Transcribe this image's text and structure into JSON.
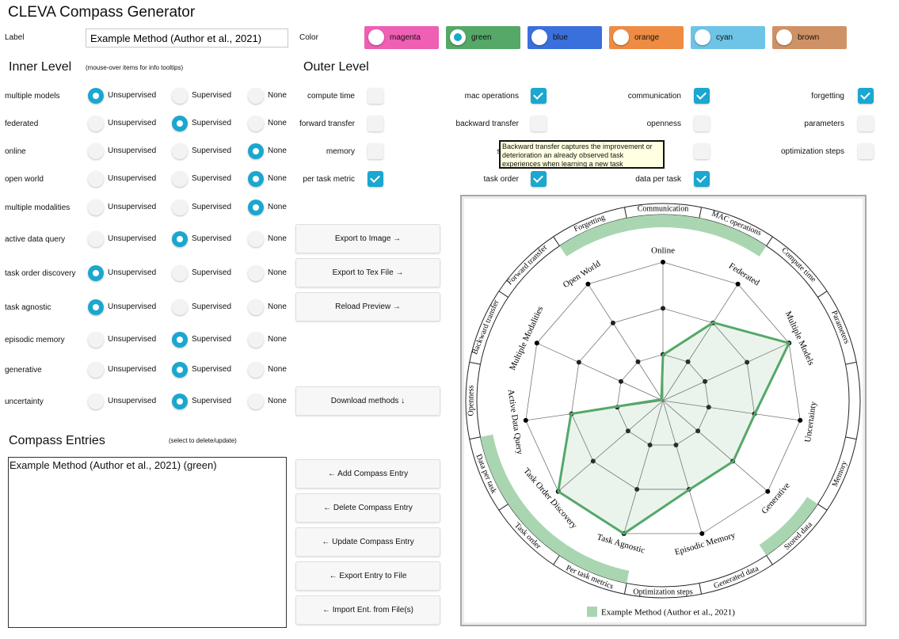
{
  "app_title": "CLEVA Compass Generator",
  "label_section": {
    "label": "Label",
    "value": "Example Method (Author et al., 2021)"
  },
  "color_section": {
    "label": "Color",
    "options": [
      {
        "name": "magenta",
        "hex": "#ef5fb4",
        "selected": false
      },
      {
        "name": "green",
        "hex": "#55a868",
        "selected": true
      },
      {
        "name": "blue",
        "hex": "#3a70dc",
        "selected": false
      },
      {
        "name": "orange",
        "hex": "#ee8c43",
        "selected": false
      },
      {
        "name": "cyan",
        "hex": "#6dc4e6",
        "selected": false
      },
      {
        "name": "brown",
        "hex": "#cf9266",
        "selected": false
      }
    ]
  },
  "inner_level": {
    "title": "Inner Level",
    "hint": "(mouse-over items for info tooltips)",
    "options": [
      "Unsupervised",
      "Supervised",
      "None"
    ],
    "rows": [
      {
        "label": "multiple models",
        "selected": "Unsupervised"
      },
      {
        "label": "federated",
        "selected": "Supervised"
      },
      {
        "label": "online",
        "selected": "None"
      },
      {
        "label": "open world",
        "selected": "None"
      },
      {
        "label": "multiple modalities",
        "selected": "None"
      },
      {
        "label": "active data query",
        "selected": "Supervised"
      },
      {
        "label": "task order discovery",
        "selected": "Unsupervised"
      },
      {
        "label": "task agnostic",
        "selected": "Unsupervised"
      },
      {
        "label": "episodic memory",
        "selected": "Supervised"
      },
      {
        "label": "generative",
        "selected": "Supervised"
      },
      {
        "label": "uncertainty",
        "selected": "Supervised"
      }
    ]
  },
  "outer_level": {
    "title": "Outer Level",
    "columns": [
      [
        {
          "label": "compute time",
          "checked": false
        },
        {
          "label": "forward transfer",
          "checked": false
        },
        {
          "label": "memory",
          "checked": false
        },
        {
          "label": "per task metric",
          "checked": true
        }
      ],
      [
        {
          "label": "mac operations",
          "checked": true
        },
        {
          "label": "backward transfer",
          "checked": false
        },
        {
          "label": "stored",
          "checked": false
        },
        {
          "label": "task order",
          "checked": true
        }
      ],
      [
        {
          "label": "communication",
          "checked": true
        },
        {
          "label": "openness",
          "checked": false
        },
        {
          "label": "",
          "checked": false
        },
        {
          "label": "data per task",
          "checked": true
        }
      ],
      [
        {
          "label": "forgetting",
          "checked": true
        },
        {
          "label": "parameters",
          "checked": false
        },
        {
          "label": "optimization steps",
          "checked": false
        }
      ]
    ]
  },
  "tooltip": "Backward transfer captures the improvement or deterioration an already observed task experiences when learning a new task",
  "actions": {
    "export_image": "Export to Image →",
    "export_tex": "Export to Tex File →",
    "reload_preview": "Reload Preview →",
    "download_methods": "Download methods ↓"
  },
  "compass_entries": {
    "title": "Compass Entries",
    "hint": "(select to delete/update)",
    "items": [
      "Example Method (Author et al., 2021) (green)"
    ]
  },
  "entry_actions": {
    "add": "← Add Compass Entry",
    "delete": "← Delete Compass Entry",
    "update": "← Update Compass Entry",
    "export": "← Export Entry to File",
    "import": "← Import Ent. from File(s)"
  },
  "compass": {
    "inner_labels": [
      "Online",
      "Federated",
      "Multiple Models",
      "Uncertainty",
      "Generative",
      "Episodic Memory",
      "Task Agnostic",
      "Task Order Discovery",
      "Active Data Query",
      "Multiple Modalities",
      "Open World"
    ],
    "inner_levels": [
      0.33,
      0.67,
      1.0,
      0.67,
      0.67,
      0.67,
      1.0,
      1.0,
      0.67,
      0.0,
      0.0
    ],
    "outer_labels": [
      "Communication",
      "MAC operations",
      "Compute time",
      "Parameters",
      "Uncertainty_spacer",
      "Memory",
      "Stored data",
      "Generated data",
      "Optimization steps",
      "Per task metrics",
      "Task order",
      "Data per task",
      "Openness",
      "Backward transfer",
      "Forward transfer",
      "Forgetting"
    ],
    "outer_checked": [
      "Communication",
      "MAC operations",
      "Stored data",
      "Per task metrics",
      "Task order",
      "Data per task",
      "Forgetting"
    ],
    "legend": "Example Method (Author et al., 2021)",
    "series_color": "#55a868"
  }
}
